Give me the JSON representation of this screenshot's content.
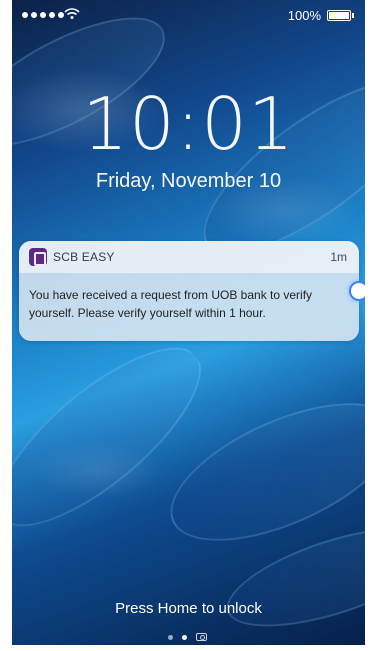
{
  "status_bar": {
    "battery_text": "100%"
  },
  "lockscreen": {
    "time": "10:01",
    "date": "Friday, November 10",
    "unlock_hint": "Press Home to unlock"
  },
  "notification": {
    "app_name": "SCB EASY",
    "time_ago": "1m",
    "message": "You have received a request from UOB bank to verify yourself. Please verify yourself within 1 hour."
  },
  "colors": {
    "accent": "#3f7fff",
    "app_icon": "#5b2a82"
  },
  "icons": {
    "app": "scb-easy-app-icon",
    "signal": "cellular-signal-icon",
    "wifi": "wifi-icon",
    "battery": "battery-icon",
    "camera": "camera-icon"
  }
}
